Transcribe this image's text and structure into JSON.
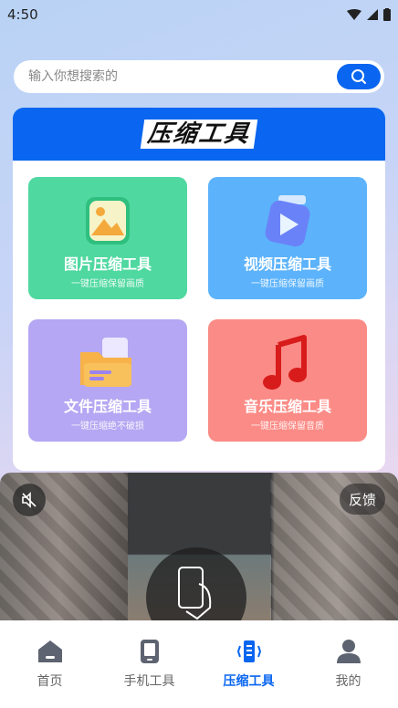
{
  "status_bar": {
    "time": "4:50"
  },
  "search": {
    "placeholder": "输入你想搜索的"
  },
  "card": {
    "title": "压缩工具"
  },
  "tools": [
    {
      "name": "图片压缩工具",
      "desc": "一键压缩保留画质",
      "icon": "image-icon"
    },
    {
      "name": "视频压缩工具",
      "desc": "一键压缩保留画质",
      "icon": "video-icon"
    },
    {
      "name": "文件压缩工具",
      "desc": "一键压缩绝不破损",
      "icon": "folder-icon"
    },
    {
      "name": "音乐压缩工具",
      "desc": "一键压缩保留音质",
      "icon": "music-note-icon"
    }
  ],
  "video": {
    "feedback_label": "反馈"
  },
  "nav": [
    {
      "label": "首页",
      "icon": "home-icon"
    },
    {
      "label": "手机工具",
      "icon": "phone-icon"
    },
    {
      "label": "压缩工具",
      "icon": "compress-icon",
      "active": true
    },
    {
      "label": "我的",
      "icon": "user-icon"
    }
  ],
  "colors": {
    "accent": "#0a66f0",
    "image_tool": "#4fd8a0",
    "video_tool": "#5cb3fb",
    "file_tool": "#b5a7f3",
    "music_tool": "#fb8b86"
  }
}
